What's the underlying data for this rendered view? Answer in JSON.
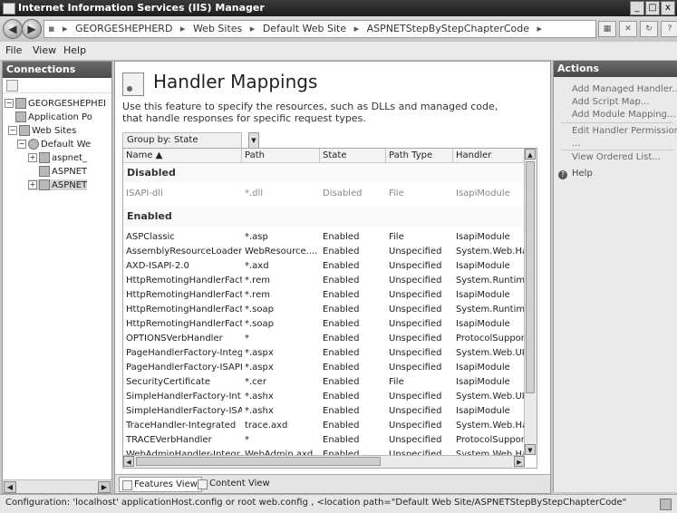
{
  "window": {
    "title": "Internet Information Services (IIS) Manager",
    "controls": [
      "_",
      "□",
      "x"
    ]
  },
  "address": {
    "crumbs": [
      "GEORGESHEPHERD",
      "Web Sites",
      "Default Web Site",
      "ASPNETStepByStepChapterCode"
    ]
  },
  "menu": {
    "file": "File",
    "view": "View",
    "help": "Help"
  },
  "connections": {
    "title": "Connections",
    "tree": [
      {
        "label": "GEORGESHEPHEI",
        "exp": "⊟"
      },
      {
        "label": "Application Po",
        "exp": ""
      },
      {
        "label": "Web Sites",
        "exp": "⊟"
      },
      {
        "label": "Default We",
        "exp": "⊟"
      },
      {
        "label": "aspnet_",
        "exp": "⊞"
      },
      {
        "label": "ASPNET",
        "exp": ""
      },
      {
        "label": "ASPNET",
        "exp": "⊞"
      }
    ]
  },
  "main": {
    "title": "Handler Mappings",
    "description": "Use this feature to specify the resources, such as DLLs and managed code, that handle responses for specific request types.",
    "group_by_label": "Group by:",
    "group_by_value": "State",
    "columns": [
      "Name ▲",
      "Path",
      "State",
      "Path Type",
      "Handler"
    ],
    "group_disabled": "Disabled",
    "group_enabled": "Enabled",
    "disabled_rows": [
      [
        "ISAPI-dll",
        "*.dll",
        "Disabled",
        "File",
        "IsapiModule"
      ]
    ],
    "enabled_rows": [
      [
        "ASPClassic",
        "*.asp",
        "Enabled",
        "File",
        "IsapiModule"
      ],
      [
        "AssemblyResourceLoader...",
        "WebResource....",
        "Enabled",
        "Unspecified",
        "System.Web.Ha"
      ],
      [
        "AXD-ISAPI-2.0",
        "*.axd",
        "Enabled",
        "Unspecified",
        "IsapiModule"
      ],
      [
        "HttpRemotingHandlerFact...",
        "*.rem",
        "Enabled",
        "Unspecified",
        "System.Runtime"
      ],
      [
        "HttpRemotingHandlerFact...",
        "*.rem",
        "Enabled",
        "Unspecified",
        "IsapiModule"
      ],
      [
        "HttpRemotingHandlerFact...",
        "*.soap",
        "Enabled",
        "Unspecified",
        "System.Runtime"
      ],
      [
        "HttpRemotingHandlerFact...",
        "*.soap",
        "Enabled",
        "Unspecified",
        "IsapiModule"
      ],
      [
        "OPTIONSVerbHandler",
        "*",
        "Enabled",
        "Unspecified",
        "ProtocolSuppor"
      ],
      [
        "PageHandlerFactory-Integ...",
        "*.aspx",
        "Enabled",
        "Unspecified",
        "System.Web.UI"
      ],
      [
        "PageHandlerFactory-ISAPI...",
        "*.aspx",
        "Enabled",
        "Unspecified",
        "IsapiModule"
      ],
      [
        "SecurityCertificate",
        "*.cer",
        "Enabled",
        "File",
        "IsapiModule"
      ],
      [
        "SimpleHandlerFactory-Int...",
        "*.ashx",
        "Enabled",
        "Unspecified",
        "System.Web.UI"
      ],
      [
        "SimpleHandlerFactory-ISA...",
        "*.ashx",
        "Enabled",
        "Unspecified",
        "IsapiModule"
      ],
      [
        "TraceHandler-Integrated",
        "trace.axd",
        "Enabled",
        "Unspecified",
        "System.Web.Ha"
      ],
      [
        "TRACEVerbHandler",
        "*",
        "Enabled",
        "Unspecified",
        "ProtocolSuppor"
      ],
      [
        "WebAdminHandler-Integr...",
        "WebAdmin.axd",
        "Enabled",
        "Unspecified",
        "System.Web.Ha"
      ]
    ],
    "features_view": "Features View",
    "content_view": "Content View"
  },
  "actions": {
    "title": "Actions",
    "items": [
      "Add Managed Handler...",
      "Add Script Map...",
      "Add Module Mapping...",
      "Edit Handler Permissions",
      "...",
      "View Ordered List..."
    ],
    "help": "Help"
  },
  "status": {
    "text": "Configuration: 'localhost' applicationHost.config or root web.config , <location path=\"Default Web Site/ASPNETStepByStepChapterCode\""
  }
}
